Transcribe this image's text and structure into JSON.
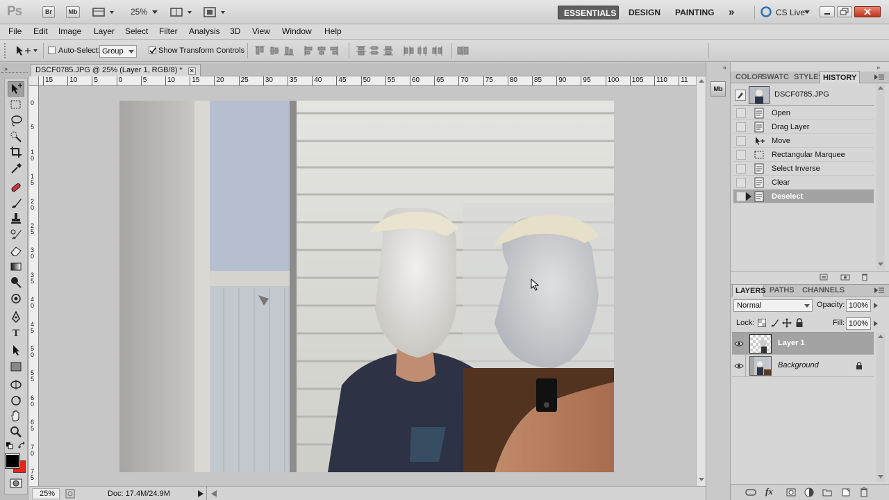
{
  "app": {
    "logo": "Ps",
    "bridge_label": "Br",
    "minibridge_label": "Mb",
    "zoom": "25%",
    "workspaces": [
      "ESSENTIALS",
      "DESIGN",
      "PAINTING"
    ],
    "more_label": "»",
    "cslive_label": "CS Live"
  },
  "menu": [
    "File",
    "Edit",
    "Image",
    "Layer",
    "Select",
    "Filter",
    "Analysis",
    "3D",
    "View",
    "Window",
    "Help"
  ],
  "options": {
    "auto_select_label": "Auto-Select:",
    "auto_select_checked": false,
    "auto_select_value": "Group",
    "show_transform_label": "Show Transform Controls",
    "show_transform_checked": true
  },
  "document": {
    "tab_title": "DSCF0785.JPG @ 25% (Layer 1, RGB/8) *",
    "ruler_h": [
      "15",
      "10",
      "5",
      "0",
      "5",
      "10",
      "15",
      "20",
      "25",
      "30",
      "35",
      "40",
      "45",
      "50",
      "55",
      "60",
      "65",
      "70",
      "75",
      "80",
      "85",
      "90",
      "95",
      "100",
      "105",
      "110",
      "11"
    ],
    "ruler_v": [
      "0",
      "5",
      "1\n0",
      "1\n5",
      "2\n0",
      "2\n5",
      "3\n0",
      "3\n5",
      "4\n0",
      "4\n5",
      "5\n0",
      "5\n5",
      "6\n0",
      "6\n5",
      "7\n0",
      "7\n5"
    ],
    "status_zoom": "25%",
    "status_doc": "Doc: 17.4M/24.9M"
  },
  "history": {
    "tabs": [
      "COLOR",
      "SWATC",
      "STYLES",
      "HISTORY"
    ],
    "active_tab": "HISTORY",
    "snapshot": "DSCF0785.JPG",
    "states": [
      "Open",
      "Drag Layer",
      "Move",
      "Rectangular Marquee",
      "Select Inverse",
      "Clear",
      "Deselect"
    ],
    "active_state": "Deselect"
  },
  "layers": {
    "tabs": [
      "LAYERS",
      "PATHS",
      "CHANNELS"
    ],
    "active_tab": "LAYERS",
    "blend_mode": "Normal",
    "opacity_label": "Opacity:",
    "opacity": "100%",
    "lock_label": "Lock:",
    "fill_label": "Fill:",
    "fill": "100%",
    "items": [
      {
        "name": "Layer 1",
        "selected": true
      },
      {
        "name": "Background",
        "selected": false,
        "locked": true
      }
    ]
  },
  "colors": {
    "foreground": "#000000",
    "background": "#e8261c",
    "accent_selection": "#a3a3a3"
  }
}
